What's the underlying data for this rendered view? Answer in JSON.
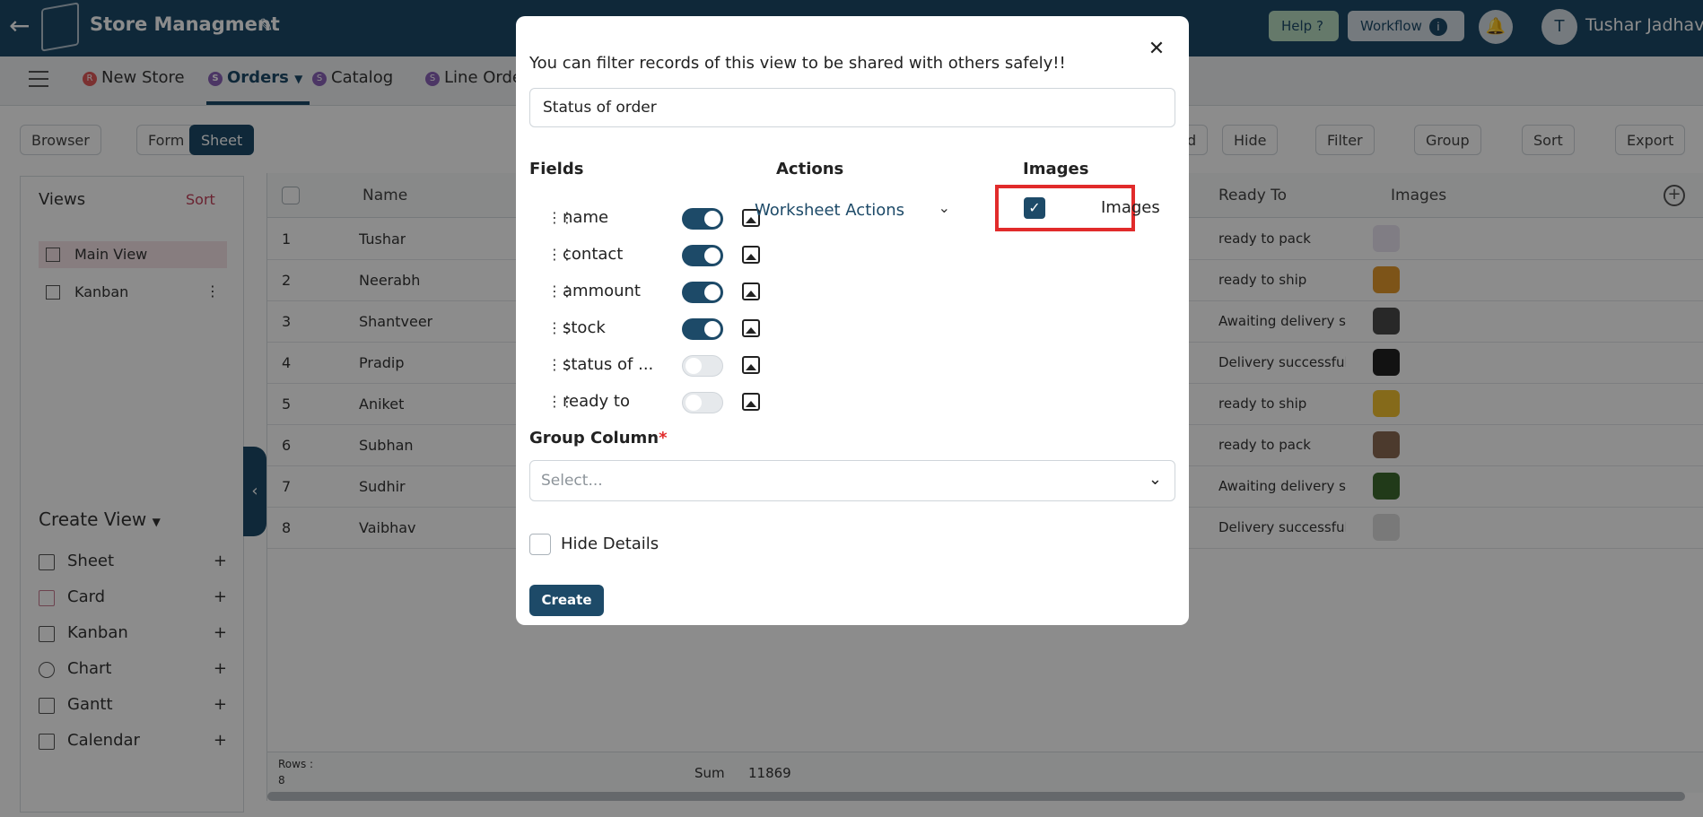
{
  "app": {
    "title": "Store Managment",
    "help_label": "Help ?",
    "workflow_label": "Workflow",
    "user_initial": "T",
    "user_name": "Tushar Jadhav"
  },
  "tabs": [
    {
      "label": "New Store",
      "badge": "R"
    },
    {
      "label": "Orders",
      "badge": "S"
    },
    {
      "label": "Catalog",
      "badge": "S"
    },
    {
      "label": "Line Orde",
      "badge": "S"
    }
  ],
  "toolbar": {
    "browser": "Browser",
    "form": "Form",
    "sheet": "Sheet",
    "d": "d",
    "hide": "Hide",
    "filter": "Filter",
    "group": "Group",
    "sort": "Sort",
    "export": "Export"
  },
  "views": {
    "heading": "Views",
    "sort": "Sort",
    "items": [
      "Main View",
      "Kanban"
    ],
    "create_heading": "Create View",
    "create_items": [
      "Sheet",
      "Card",
      "Kanban",
      "Chart",
      "Gantt",
      "Calendar"
    ]
  },
  "grid": {
    "headers": {
      "name": "Name",
      "ready_to": "Ready To",
      "images": "Images"
    },
    "rows": [
      {
        "n": "1",
        "name": "Tushar",
        "ready": "ready to pack",
        "thumb": "#e9e4f0"
      },
      {
        "n": "2",
        "name": "Neerabh",
        "ready": "ready to ship",
        "thumb": "#e39a2d"
      },
      {
        "n": "3",
        "name": "Shantveer",
        "ready": "Awaiting delivery sta",
        "thumb": "#4a4a4a"
      },
      {
        "n": "4",
        "name": "Pradip",
        "ready": "Delivery successful",
        "thumb": "#222222"
      },
      {
        "n": "5",
        "name": "Aniket",
        "ready": "ready to ship",
        "thumb": "#f2c230"
      },
      {
        "n": "6",
        "name": "Subhan",
        "ready": "ready to pack",
        "thumb": "#8a6a52"
      },
      {
        "n": "7",
        "name": "Sudhir",
        "ready": "Awaiting delivery sta",
        "thumb": "#3c6b2f"
      },
      {
        "n": "8",
        "name": "Vaibhav",
        "ready": "Delivery successful",
        "thumb": "#dcdcdc"
      }
    ],
    "footer": {
      "rows_label": "Rows :",
      "rows_count": "8",
      "sum_label": "Sum",
      "sum_value": "11869"
    }
  },
  "modal": {
    "message": "You can filter records of this view to be shared with others safely!!",
    "search_value": "Status of order",
    "fields_heading": "Fields",
    "actions_heading": "Actions",
    "images_heading": "Images",
    "fields": [
      {
        "name": "name",
        "enabled": true
      },
      {
        "name": "contact",
        "enabled": true
      },
      {
        "name": "ammount",
        "enabled": true
      },
      {
        "name": "stock",
        "enabled": true
      },
      {
        "name": "status of ...",
        "enabled": false
      },
      {
        "name": "ready to",
        "enabled": false
      }
    ],
    "actions_value": "Worksheet Actions",
    "images_checkbox_label": "Images",
    "images_checked": true,
    "group_column_label": "Group Column",
    "group_column_required": "*",
    "group_column_placeholder": "Select...",
    "hide_details_label": "Hide Details",
    "hide_details_checked": false,
    "create_label": "Create"
  },
  "colors": {
    "primary": "#1d4a68",
    "highlight_box": "#e12b2b"
  }
}
